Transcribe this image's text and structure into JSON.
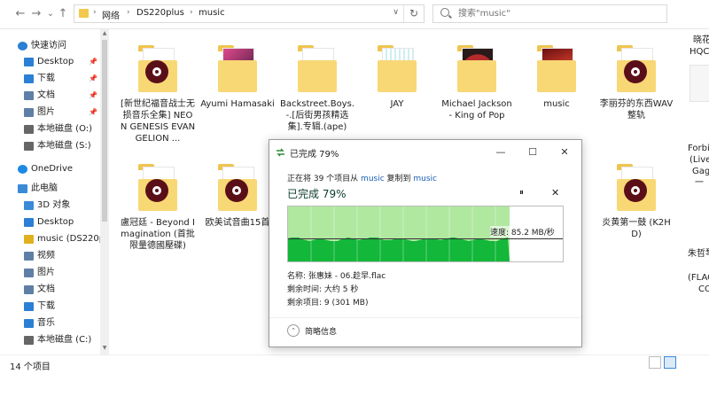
{
  "toolbar": {
    "back": "←",
    "forward": "→",
    "recent": "⌄",
    "up": "↑",
    "breadcrumb": [
      "网络",
      "DS220plus",
      "music"
    ],
    "refresh": "↻",
    "search_placeholder": "搜索\"music\""
  },
  "nav": {
    "items": [
      {
        "label": "快速访问",
        "icon": "star-icon",
        "color": "#2b7fd4"
      },
      {
        "label": "Desktop",
        "icon": "desktop-icon",
        "color": "#2b7fd4",
        "pinned": true
      },
      {
        "label": "下载",
        "icon": "download-icon",
        "color": "#2b7fd4",
        "pinned": true
      },
      {
        "label": "文档",
        "icon": "document-icon",
        "color": "#5f7fa6",
        "pinned": true
      },
      {
        "label": "图片",
        "icon": "picture-icon",
        "color": "#5f7fa6",
        "pinned": true
      },
      {
        "label": "本地磁盘 (O:)",
        "icon": "drive-icon",
        "color": "#666666"
      },
      {
        "label": "本地磁盘 (S:)",
        "icon": "drive-icon",
        "color": "#666666"
      },
      {
        "label": "OneDrive",
        "icon": "cloud-icon",
        "color": "#1e88e5"
      },
      {
        "label": "此电脑",
        "icon": "computer-icon",
        "color": "#3a8ad8"
      },
      {
        "label": "3D 对象",
        "icon": "cube-icon",
        "color": "#3a8ad8"
      },
      {
        "label": "Desktop",
        "icon": "desktop-icon",
        "color": "#2b7fd4"
      },
      {
        "label": "music (DS220p",
        "icon": "network-drive-icon",
        "color": "#e0b020"
      },
      {
        "label": "视频",
        "icon": "video-icon",
        "color": "#5f7fa6"
      },
      {
        "label": "图片",
        "icon": "picture-icon",
        "color": "#5f7fa6"
      },
      {
        "label": "文档",
        "icon": "document-icon",
        "color": "#5f7fa6"
      },
      {
        "label": "下载",
        "icon": "download-icon",
        "color": "#2b7fd4"
      },
      {
        "label": "音乐",
        "icon": "music-note-icon",
        "color": "#2b7fd4"
      },
      {
        "label": "本地磁盘 (C:)",
        "icon": "drive-icon",
        "color": "#666666"
      }
    ],
    "pin_glyph": "📌"
  },
  "files": [
    {
      "name": "[新世纪福音战士无损音乐全集] NEON GENESIS EVANGELION ..."
    },
    {
      "name": "Ayumi Hamasaki"
    },
    {
      "name": "Backstreet.Boys.-.[后街男孩精选集].专辑.(ape)"
    },
    {
      "name": "JAY"
    },
    {
      "name": "Michael Jackson - King of Pop"
    },
    {
      "name": "music"
    },
    {
      "name": "李丽芬的东西WAV整轨"
    },
    {
      "name": "盧冠廷 - Beyond Imagination (首批限量德國壓碟)"
    },
    {
      "name": "欧美试音曲15首"
    },
    {
      "name": "炎黄第一鼓 (K2HD)"
    }
  ],
  "right_strip": [
    "晓花",
    "HQC",
    "Forbi",
    "(Live)",
    "Gag",
    "一",
    "朱哲琴",
    "(FLAC",
    "CO"
  ],
  "status": {
    "count": "14 个项目"
  },
  "dialog": {
    "title": "已完成 79%",
    "line_prefix": "正在将 39 个项目从 ",
    "source": "music",
    "line_middle": " 复制到 ",
    "target": "music",
    "percent_label": "已完成 79%",
    "pause_glyph": "⏸",
    "close_glyph": "✕",
    "speed": "速度: 85.2 MB/秒",
    "name_line": "名称: 张惠妹 - 06.趁早.flac",
    "time_line": "剩余时间: 大约 5 秒",
    "items_line": "剩余项目: 9 (301 MB)",
    "footer": "简略信息",
    "minimize": "—",
    "maximize": "☐",
    "window_close": "✕",
    "progress": 0.79,
    "fill_color": "#13b73a",
    "light_color": "#b0e8a0"
  }
}
